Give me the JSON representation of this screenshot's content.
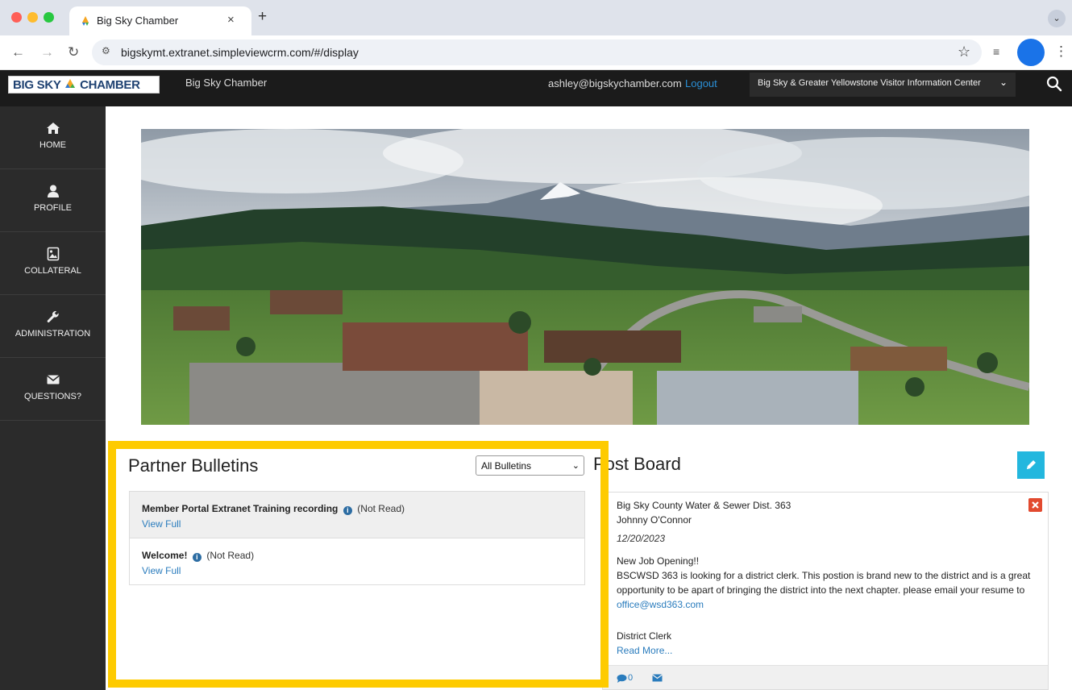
{
  "browser": {
    "tab_title": "Big Sky Chamber",
    "tab_close": "×",
    "new_tab": "+",
    "tab_menu": "⌄",
    "url": "bigskymt.extranet.simpleviewcrm.com/#/display"
  },
  "header": {
    "logo_text_1": "BIG SKY",
    "logo_text_2": "CHAMBER",
    "title": "Big Sky Chamber",
    "email": "ashley@bigskychamber.com",
    "logout": "Logout",
    "organization": "Big Sky & Greater Yellowstone Visitor Information Center"
  },
  "sidebar": {
    "items": [
      {
        "label": "HOME",
        "icon": "home-icon"
      },
      {
        "label": "PROFILE",
        "icon": "user-icon"
      },
      {
        "label": "COLLATERAL",
        "icon": "image-file-icon"
      },
      {
        "label": "ADMINISTRATION",
        "icon": "wrench-icon"
      },
      {
        "label": "QUESTIONS?",
        "icon": "envelope-icon"
      }
    ]
  },
  "bulletins": {
    "title": "Partner Bulletins",
    "filter_selected": "All Bulletins",
    "items": [
      {
        "title": "Member Portal Extranet Training recording",
        "status": "(Not Read)",
        "link": "View Full"
      },
      {
        "title": "Welcome!",
        "status": "(Not Read)",
        "link": "View Full"
      }
    ]
  },
  "postboard": {
    "title": "Post Board",
    "post": {
      "organization": "Big Sky County Water & Sewer Dist. 363",
      "author": "Johnny O'Connor",
      "date": "12/20/2023",
      "headline": "New Job Opening!!",
      "body": "BSCWSD 363 is looking for a district clerk. This postion is brand new to the district and is a great opportunity to be apart of bringing the district into the next chapter. please email your resume to ",
      "email_link": "office@wsd363.com",
      "subject": "District Clerk",
      "read_more": "Read More...",
      "comment_count": "0"
    }
  },
  "colors": {
    "highlight": "#fecb00",
    "sidebar_bg": "#2b2b2b",
    "header_bg": "#1b1b1b",
    "link": "#2a7cbd",
    "edit_button": "#23b7de",
    "delete_button": "#e24a2f"
  }
}
